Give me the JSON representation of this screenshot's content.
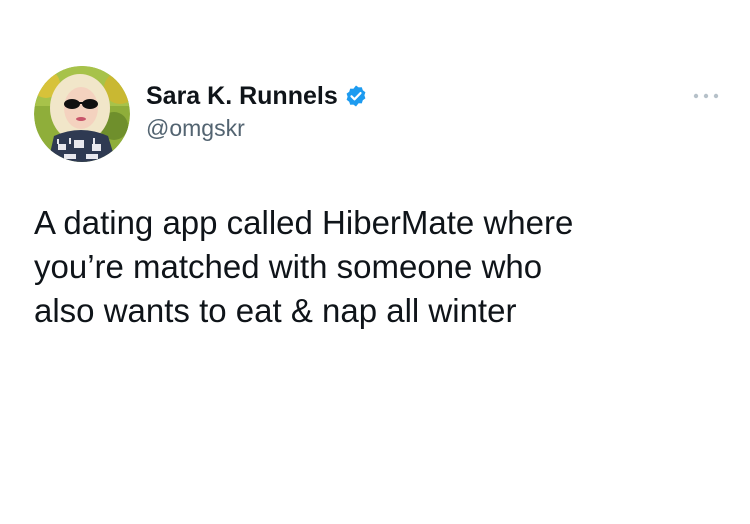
{
  "tweet": {
    "author": {
      "name": "Sara K. Runnels",
      "handle": "@omgskr",
      "verified": true,
      "avatar_icon": "profile-photo"
    },
    "more_icon": "more-options-icon",
    "text": "A dating app called HiberMate where\nyou’re matched with someone who\nalso wants to eat & nap all winter"
  },
  "colors": {
    "text": "#0f1419",
    "handle": "#536471",
    "verified_badge": "#1d9bf0",
    "background": "#ffffff"
  }
}
